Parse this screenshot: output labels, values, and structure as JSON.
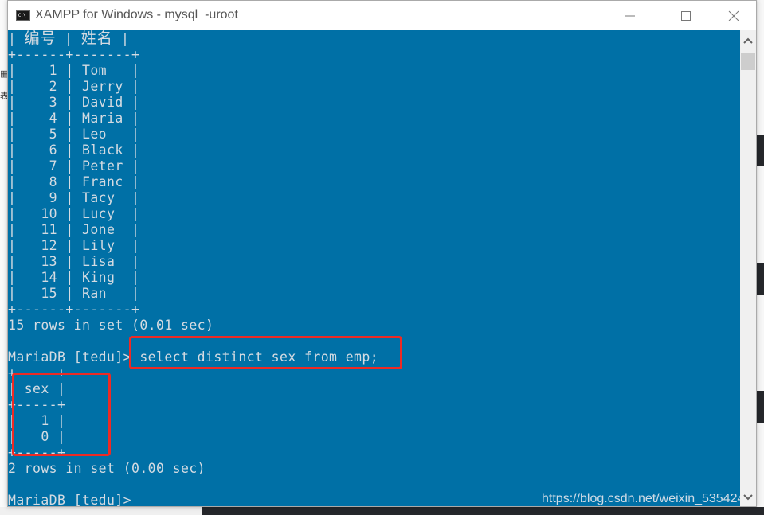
{
  "window": {
    "title": "XAMPP for Windows - mysql  -uroot",
    "icon": "cmd-icon",
    "icon_text": "C:\\_",
    "controls": {
      "minimize": "minimize-icon",
      "maximize": "maximize-icon",
      "close": "close-icon"
    }
  },
  "console": {
    "colors": {
      "background": "#0070a6",
      "text": "#d4dbe2",
      "highlight": "#ee2a24"
    },
    "table1": {
      "header_line": "| 编号 | 姓名 |",
      "columns": [
        "编号",
        "姓名"
      ],
      "border_top": "+------+-------+",
      "border_bottom": "+------+-------+",
      "rows": [
        {
          "id": "1",
          "name": "Tom"
        },
        {
          "id": "2",
          "name": "Jerry"
        },
        {
          "id": "3",
          "name": "David"
        },
        {
          "id": "4",
          "name": "Maria"
        },
        {
          "id": "5",
          "name": "Leo"
        },
        {
          "id": "6",
          "name": "Black"
        },
        {
          "id": "7",
          "name": "Peter"
        },
        {
          "id": "8",
          "name": "Franc"
        },
        {
          "id": "9",
          "name": "Tacy"
        },
        {
          "id": "10",
          "name": "Lucy"
        },
        {
          "id": "11",
          "name": "Jone"
        },
        {
          "id": "12",
          "name": "Lily"
        },
        {
          "id": "13",
          "name": "Lisa"
        },
        {
          "id": "14",
          "name": "King"
        },
        {
          "id": "15",
          "name": "Ran"
        }
      ],
      "lines": [
        "|    1 | Tom   |",
        "|    2 | Jerry |",
        "|    3 | David |",
        "|    4 | Maria |",
        "|    5 | Leo   |",
        "|    6 | Black |",
        "|    7 | Peter |",
        "|    8 | Franc |",
        "|    9 | Tacy  |",
        "|   10 | Lucy  |",
        "|   11 | Jone  |",
        "|   12 | Lily  |",
        "|   13 | Lisa  |",
        "|   14 | King  |",
        "|   15 | Ran   |"
      ],
      "result": "15 rows in set (0.01 sec)"
    },
    "query": {
      "prompt": "MariaDB [tedu]> ",
      "command": "select distinct sex from emp;"
    },
    "table2": {
      "border": "+-----+",
      "header_line": "| sex |",
      "columns": [
        "sex"
      ],
      "rows": [
        "1",
        "0"
      ],
      "lines": [
        "|   1 |",
        "|   0 |"
      ],
      "result": "2 rows in set (0.00 sec)"
    },
    "final_prompt": "MariaDB [tedu]>"
  },
  "watermark": "https://blog.csdn.net/weixin_535424"
}
